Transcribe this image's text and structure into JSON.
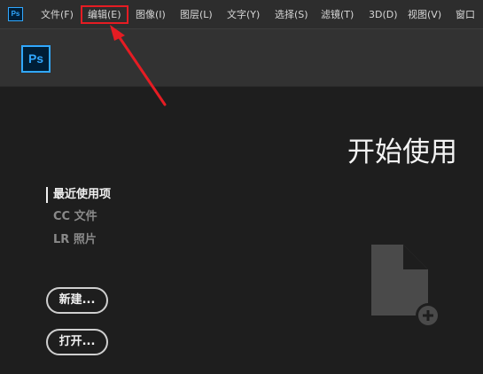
{
  "menubar": {
    "app_icon_text": "Ps",
    "items": [
      {
        "label": "文件(F)"
      },
      {
        "label": "编辑(E)"
      },
      {
        "label": "图像(I)"
      },
      {
        "label": "图层(L)"
      },
      {
        "label": "文字(Y)"
      },
      {
        "label": "选择(S)"
      },
      {
        "label": "滤镜(T)"
      },
      {
        "label": "3D(D)"
      },
      {
        "label": "视图(V)"
      },
      {
        "label": "窗口"
      }
    ]
  },
  "header": {
    "logo_text": "Ps"
  },
  "main": {
    "title": "开始使用",
    "nav": [
      {
        "label": "最近使用项"
      },
      {
        "label": "CC 文件"
      },
      {
        "label": "LR 照片"
      }
    ],
    "buttons": {
      "new_label": "新建...",
      "open_label": "打开..."
    }
  },
  "colors": {
    "accent": "#31a8ff",
    "highlight": "#e51c23",
    "background": "#1e1e1e",
    "header": "#323232",
    "menubar": "#2d2d2d"
  },
  "icons": [
    "ps-logo-icon",
    "new-document-icon",
    "plus-circle-icon",
    "red-arrow-annotation"
  ]
}
